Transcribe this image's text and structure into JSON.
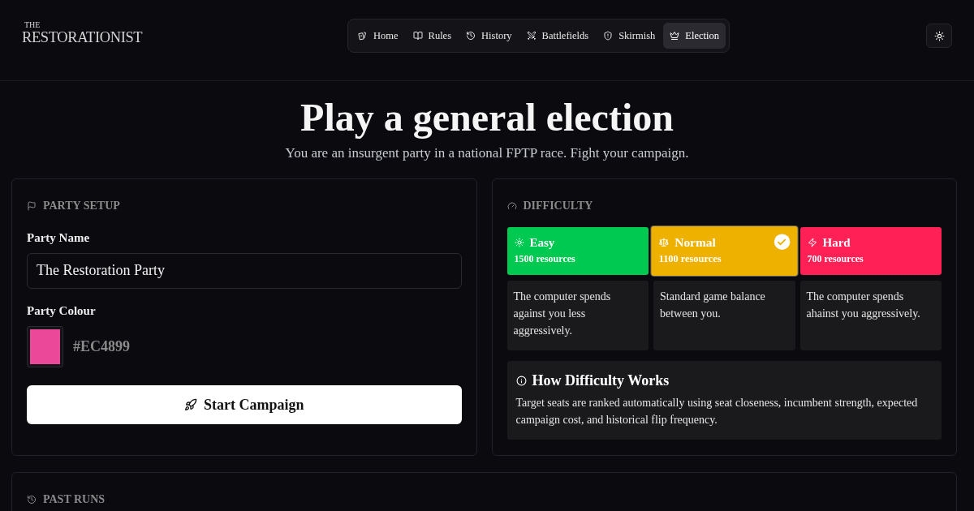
{
  "header": {
    "logo": {
      "small": "THE",
      "main": "RESTORATIONIST"
    },
    "nav": [
      {
        "label": "Home",
        "selected": false
      },
      {
        "label": "Rules",
        "selected": false
      },
      {
        "label": "History",
        "selected": false
      },
      {
        "label": "Battlefields",
        "selected": false
      },
      {
        "label": "Skirmish",
        "selected": false
      },
      {
        "label": "Election",
        "selected": true
      }
    ]
  },
  "hero": {
    "title": "Play a general election",
    "subtitle": "You are an insurgent party in a national FPTP race. Fight your campaign."
  },
  "party_setup": {
    "heading": "PARTY SETUP",
    "name_label": "Party Name",
    "name_value": "The Restoration Party",
    "colour_label": "Party Colour",
    "colour": {
      "value": "#EC4899",
      "color": "#ec4899"
    },
    "start_button": "Start Campaign"
  },
  "difficulty": {
    "heading": "DIFFICULTY",
    "options": [
      {
        "label": "Easy",
        "resources": "1500 resources",
        "description": "The computer spends against you less aggressively.",
        "color": "#00c951",
        "selected": false
      },
      {
        "label": "Normal",
        "resources": "1100 resources",
        "description": "Standard game balance between you.",
        "color": "#efb100",
        "selected": true
      },
      {
        "label": "Hard",
        "resources": "700 resources",
        "description": "The computer spends ahainst you aggressively.",
        "color": "#ff2056",
        "selected": false
      }
    ],
    "info": {
      "title": "How Difficulty Works",
      "body": "Target seats are ranked automatically using seat closeness, incumbent strength, expected campaign cost, and historical flip frequency."
    }
  },
  "past_runs": {
    "heading": "PAST RUNS"
  }
}
